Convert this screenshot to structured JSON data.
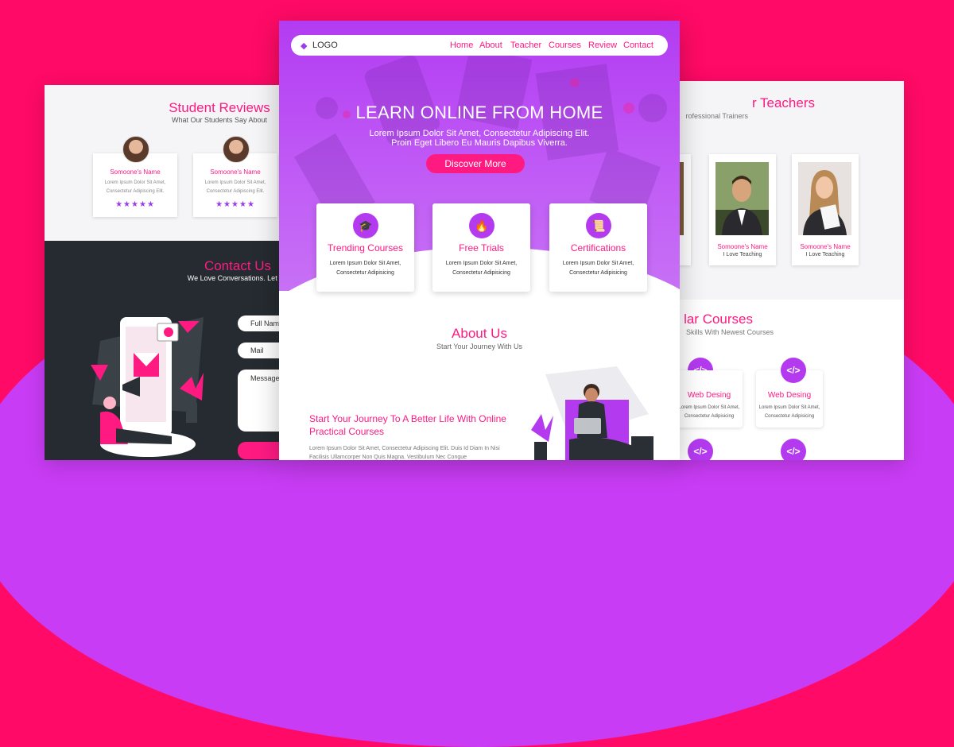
{
  "colors": {
    "pink": "#ff1a82",
    "purple": "#b43af0",
    "dark": "#252b30"
  },
  "reviews_panel": {
    "title": "Student Reviews",
    "subtitle": "What Our Students Say About",
    "cards": [
      {
        "name": "Somoone's Name",
        "text": "Lorem Ipsum Dolor Sit Amet, Consectetur Adipiscing Elit.",
        "stars": "★★★★★"
      },
      {
        "name": "Somoone's Name",
        "text": "Lorem Ipsum Dolor Sit Amet, Consectetur Adipiscing Elit.",
        "stars": "★★★★★"
      }
    ],
    "contact": {
      "title": "Contact Us",
      "subtitle": "We Love Conversations. Let Us",
      "fields": [
        "Full Name",
        "Mail",
        "Message"
      ],
      "send_label": "S"
    }
  },
  "center": {
    "logo": "LOGO",
    "nav": [
      "Home",
      "About",
      "Teacher",
      "Courses",
      "Review",
      "Contact"
    ],
    "hero_title": "LEARN ONLINE FROM HOME",
    "hero_sub": "Lorem Ipsum Dolor Sit Amet, Consectetur Adipiscing Elit. Proin Eget Libero Eu Mauris Dapibus Viverra.",
    "cta": "Discover More",
    "features": [
      {
        "icon": "graduation-cap-icon",
        "glyph": "🎓",
        "title": "Trending Courses",
        "text": "Lorem Ipsum Dolor Sit Amet, Consectetur Adipisicing"
      },
      {
        "icon": "flame-icon",
        "glyph": "🔥",
        "title": "Free Trials",
        "text": "Lorem Ipsum Dolor Sit Amet, Consectetur Adipisicing"
      },
      {
        "icon": "certificate-icon",
        "glyph": "📜",
        "title": "Certifications",
        "text": "Lorem Ipsum Dolor Sit Amet, Consectetur Adipisicing"
      }
    ],
    "about_title": "About Us",
    "about_sub": "Start Your Journey With Us",
    "about_heading": "Start Your Journey To A Better Life With Online Practical Courses",
    "about_text": "Lorem Ipsum Dolor Sit Amet, Consectetur Adipiscing Elit. Duis Id Diam In Nisi Facilisis Ullamcorper Non Quis Magna. Vestibulum Nec Congue"
  },
  "teachers_panel": {
    "title": "r Teachers",
    "subtitle": "rofessional Trainers",
    "cards": [
      {
        "name": "me",
        "role": ""
      },
      {
        "name": "Somoone's Name",
        "role": "I Love Teaching"
      },
      {
        "name": "Somoone's Name",
        "role": "I Love Teaching"
      }
    ],
    "courses_title": "lar Courses",
    "courses_sub": "Skills With Newest Courses",
    "courses": [
      {
        "icon": "code-icon",
        "glyph": "</>",
        "name": "Web Desing",
        "text": "Lorem Ipsum Dolor Sit Amet, Consectetur Adipisicing"
      },
      {
        "icon": "code-icon",
        "glyph": "</>",
        "name": "Web Desing",
        "text": "Lorem Ipsum Dolor Sit Amet, Consectetur Adipisicing"
      }
    ]
  }
}
